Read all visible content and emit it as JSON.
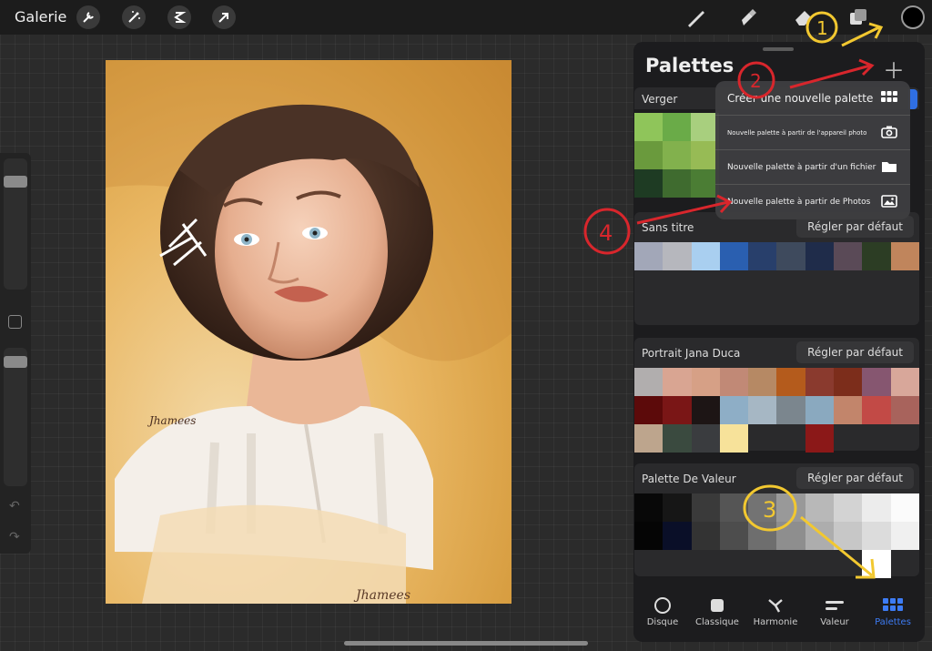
{
  "topbar": {
    "gallery_label": "Galerie",
    "left_tools": [
      "wrench-icon",
      "magic-wand-icon",
      "selection-icon",
      "transform-arrow-icon"
    ],
    "right_tools": [
      "brush-icon",
      "smudge-icon",
      "eraser-icon",
      "layers-icon"
    ],
    "current_color": "#000000"
  },
  "sidebar": {
    "icons": [
      "undo-icon",
      "redo-icon"
    ]
  },
  "canvas": {
    "signature_top": "Jhamees",
    "signature_bottom": "Jhamees"
  },
  "palettes": {
    "title": "Palettes",
    "default_label": "Régler par défaut",
    "cards": [
      {
        "name": "Verger",
        "swatches": [
          "#8fc55a",
          "#6aab48",
          "#a8cf7e",
          "#6a9a3d",
          "#82b14d",
          "#97bb55",
          "#1e3b23",
          "#3f6b2f",
          "#4b7d34"
        ]
      },
      {
        "name": "Sans titre",
        "swatches": [
          "#a2a7b8",
          "#b6b7bd",
          "#a9cff0",
          "#2a5fb0",
          "#283f6b",
          "#3e4a5d",
          "#1f2c4a",
          "#5a4a57",
          "#2c3d24",
          "#c0855c"
        ]
      },
      {
        "name": "Portrait Jana Duca",
        "swatches": [
          "#b1aeae",
          "#d9a592",
          "#d6a086",
          "#c18976",
          "#b68964",
          "#b45b1c",
          "#8a3a2e",
          "#7c2d1b",
          "#865670",
          "#d8a79a",
          "#5c0a0a",
          "#7a1616",
          "#1d1515",
          "#8eaec6",
          "#a6b7c4",
          "#7b868e",
          "#8aa9bf",
          "#c2856b",
          "#c24a46",
          "#a8635c",
          "#bda58d",
          "#3a4a3f",
          "#3a3c3f",
          "#f7e29a",
          "",
          "",
          "#8b1818",
          "",
          "",
          ""
        ]
      },
      {
        "name": "Palette De Valeur",
        "swatches": [
          "#080808",
          "#161616",
          "#3a3a3a",
          "#555555",
          "#737373",
          "#999999",
          "#b8b8b8",
          "#d3d3d3",
          "#ececec",
          "#fbfbfb",
          "#050505",
          "#0a0f28",
          "#333333",
          "#4d4d4d",
          "#6e6e6e",
          "#8e8e8e",
          "#adadad",
          "#c7c7c7",
          "#dcdcdc",
          "#f0f0f0",
          "",
          "",
          "",
          "",
          "",
          "",
          "",
          "",
          "#ffffff",
          ""
        ]
      }
    ]
  },
  "popup": {
    "items": [
      {
        "label": "Créer une nouvelle palette",
        "icon": "grid-icon"
      },
      {
        "label": "Nouvelle palette à partir de l'appareil photo",
        "icon": "camera-icon"
      },
      {
        "label": "Nouvelle palette à partir d'un fichier",
        "icon": "folder-icon"
      },
      {
        "label": "Nouvelle palette à partir de Photos",
        "icon": "photo-icon"
      }
    ]
  },
  "annotations": [
    "1",
    "2",
    "3",
    "4"
  ],
  "tabs": [
    {
      "label": "Disque",
      "icon": "disc-icon"
    },
    {
      "label": "Classique",
      "icon": "square-icon"
    },
    {
      "label": "Harmonie",
      "icon": "harmony-icon"
    },
    {
      "label": "Valeur",
      "icon": "value-icon"
    },
    {
      "label": "Palettes",
      "icon": "palettes-grid-icon"
    }
  ],
  "colors": {
    "accent": "#3d7cf5",
    "annotation_red": "#d8262c",
    "annotation_yellow": "#f2c830"
  }
}
